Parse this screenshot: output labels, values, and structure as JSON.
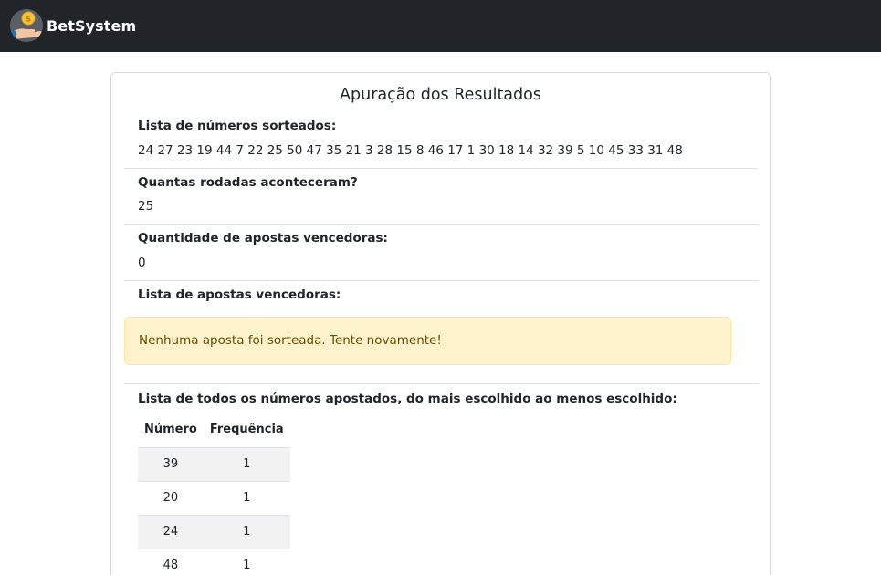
{
  "app": {
    "brand_name": "BetSystem",
    "logo_icon": "coin-in-hand-icon",
    "navbar_color": "#212529"
  },
  "card": {
    "title": "Apuração dos Resultados"
  },
  "sections": {
    "drawn": {
      "label": "Lista de números sorteados:",
      "value": "24 27 23 19 44 7 22 25 50 47 35 21 3 28 15 8 46 17 1 30 18 14 32 39 5 10 45 33 31 48"
    },
    "rounds": {
      "label": "Quantas rodadas aconteceram?",
      "value": "25"
    },
    "winners_count": {
      "label": "Quantidade de apostas vencedoras:",
      "value": "0"
    },
    "winners_list": {
      "label": "Lista de apostas vencedoras:",
      "alert": "Nenhuma aposta foi sorteada. Tente novamente!",
      "alert_color": "#fff3cd"
    },
    "all_numbers": {
      "label": "Lista de todos os números apostados, do mais escolhido ao menos escolhido:",
      "table": {
        "headers": [
          "Número",
          "Frequência"
        ],
        "rows": [
          [
            "39",
            "1"
          ],
          [
            "20",
            "1"
          ],
          [
            "24",
            "1"
          ],
          [
            "48",
            "1"
          ]
        ]
      }
    }
  }
}
